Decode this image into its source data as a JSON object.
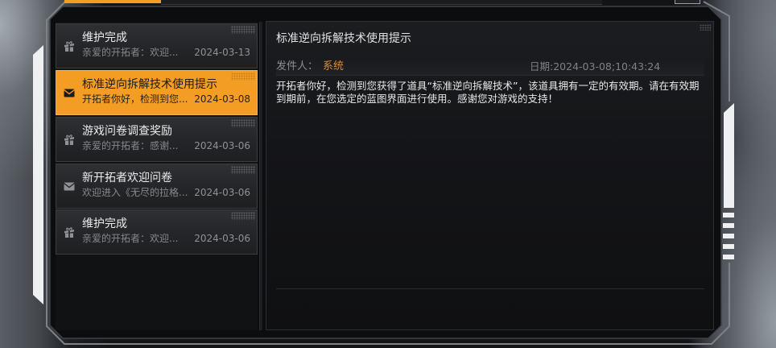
{
  "mail_list": [
    {
      "title": "维护完成",
      "preview": "亲爱的开拓者：欢迎...",
      "date": "2024-03-13",
      "icon": "gift-icon",
      "selected": false
    },
    {
      "title": "标准逆向拆解技术使用提示",
      "preview": "开拓者你好，检测到您...",
      "date": "2024-03-08",
      "icon": "envelope-icon",
      "selected": true
    },
    {
      "title": "游戏问卷调查奖励",
      "preview": "亲爱的开拓者：感谢...",
      "date": "2024-03-06",
      "icon": "gift-icon",
      "selected": false
    },
    {
      "title": "新开拓者欢迎问卷",
      "preview": "欢迎进入《无尽的拉格...",
      "date": "2024-03-06",
      "icon": "envelope-icon",
      "selected": false
    },
    {
      "title": "维护完成",
      "preview": "亲爱的开拓者：欢迎...",
      "date": "2024-03-06",
      "icon": "gift-icon",
      "selected": false
    }
  ],
  "detail": {
    "title": "标准逆向拆解技术使用提示",
    "sender_label": "发件人：",
    "sender": "系统",
    "date_text": "日期:2024-03-08;10:43:24",
    "body": "开拓者你好，检测到您获得了道具“标准逆向拆解技术”，该道具拥有一定的有效期。请在有效期到期前，在您选定的蓝图界面进行使用。感谢您对游戏的支持！"
  },
  "colors": {
    "accent": "#f49d25",
    "sender": "#e08a2c"
  }
}
